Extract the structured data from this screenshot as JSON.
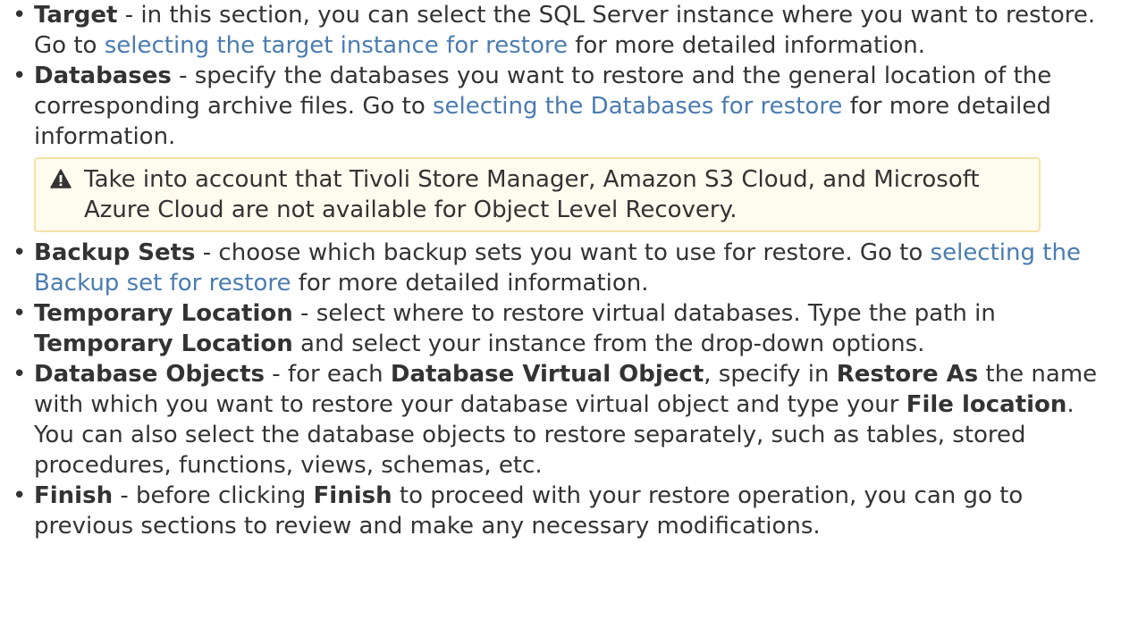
{
  "items": [
    {
      "term": "Target",
      "text1": " - in this section, you can select the SQL Server instance where you want to restore. Go to ",
      "link": "selecting the target instance for restore",
      "text2": " for more detailed information."
    },
    {
      "term": "Databases",
      "text1": " - specify the databases you want to restore and the general location of the corresponding archive files. Go to ",
      "link": "selecting the Databases for restore",
      "text2": " for more detailed information."
    },
    {
      "term": "Backup Sets",
      "text1": " -  choose which backup sets you want to use for restore. Go to ",
      "link": "selecting the Backup set for restore",
      "text2": " for more detailed information."
    },
    {
      "term": "Temporary Location",
      "text1": " - select where to restore virtual databases. Type the path in ",
      "term2": "Temporary Location",
      "text2": " and select your instance from the drop-down options."
    },
    {
      "term": "Database Objects",
      "text1": " - for each ",
      "term2": "Database Virtual Object",
      "text2": ", specify in ",
      "term3": "Restore As",
      "text3": " the name with which you want to restore your database virtual object and type your ",
      "term4": "File location",
      "text4": ". You can also select the database objects to restore separately, such as tables, stored procedures, functions, views, schemas, etc."
    },
    {
      "term": "Finish",
      "text1": " - before clicking ",
      "term2": "Finish",
      "text2": " to proceed with your restore operation, you can go to previous sections to review and make any necessary modifications."
    }
  ],
  "note": {
    "icon": "warning-icon",
    "text": "Take into account that Tivoli Store Manager, Amazon S3 Cloud, and Microsoft Azure Cloud are not available for Object Level Recovery."
  },
  "bullet": "•",
  "colors": {
    "link": "#4a7cb0",
    "note_bg": "#fffbee",
    "note_border": "#f5e2a6",
    "text": "#333333"
  }
}
